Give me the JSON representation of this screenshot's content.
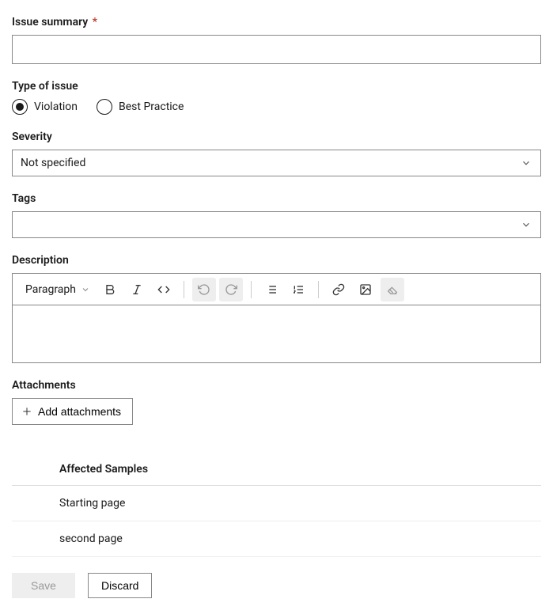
{
  "fields": {
    "issue_summary": {
      "label": "Issue summary",
      "required_marker": "*",
      "value": ""
    },
    "type_of_issue": {
      "label": "Type of issue",
      "options": [
        {
          "label": "Violation",
          "selected": true
        },
        {
          "label": "Best Practice",
          "selected": false
        }
      ]
    },
    "severity": {
      "label": "Severity",
      "value": "Not specified"
    },
    "tags": {
      "label": "Tags",
      "value": ""
    },
    "description": {
      "label": "Description",
      "toolbar": {
        "style_selector": "Paragraph"
      },
      "value": ""
    },
    "attachments": {
      "label": "Attachments",
      "button_label": "Add attachments"
    }
  },
  "affected_samples": {
    "header": "Affected Samples",
    "rows": [
      {
        "label": "Starting page"
      },
      {
        "label": "second page"
      }
    ]
  },
  "footer": {
    "save_label": "Save",
    "discard_label": "Discard"
  }
}
